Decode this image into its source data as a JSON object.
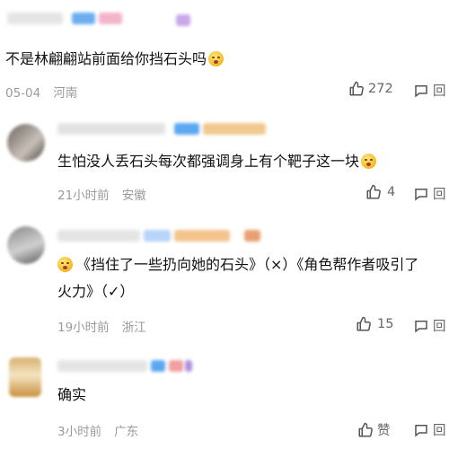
{
  "comments": [
    {
      "text": "不是林翩翩站前面给你挡石头吗",
      "date": "05-04",
      "location": "河南",
      "likes": "272",
      "reply_label": "回"
    },
    {
      "text": "生怕没人丢石头每次都强调身上有个靶子这一块",
      "date": "21小时前",
      "location": "安徽",
      "likes": "4",
      "reply_label": "回"
    },
    {
      "text_line1": "《挡住了一些扔向她的石头》（×）《角色帮作者吸引了",
      "text_line2": "火力》（✓）",
      "date": "19小时前",
      "location": "浙江",
      "likes": "15",
      "reply_label": "回"
    },
    {
      "text": "确实",
      "date": "3小时前",
      "location": "广东",
      "likes": "赞",
      "reply_label": "回"
    }
  ],
  "colors": {
    "text": "#111111",
    "meta": "#9a9a9a",
    "icon": "#555555",
    "badge_blue": "#5aa8f0",
    "badge_orange": "#f0a060",
    "badge_purple": "#c9a3e8"
  }
}
